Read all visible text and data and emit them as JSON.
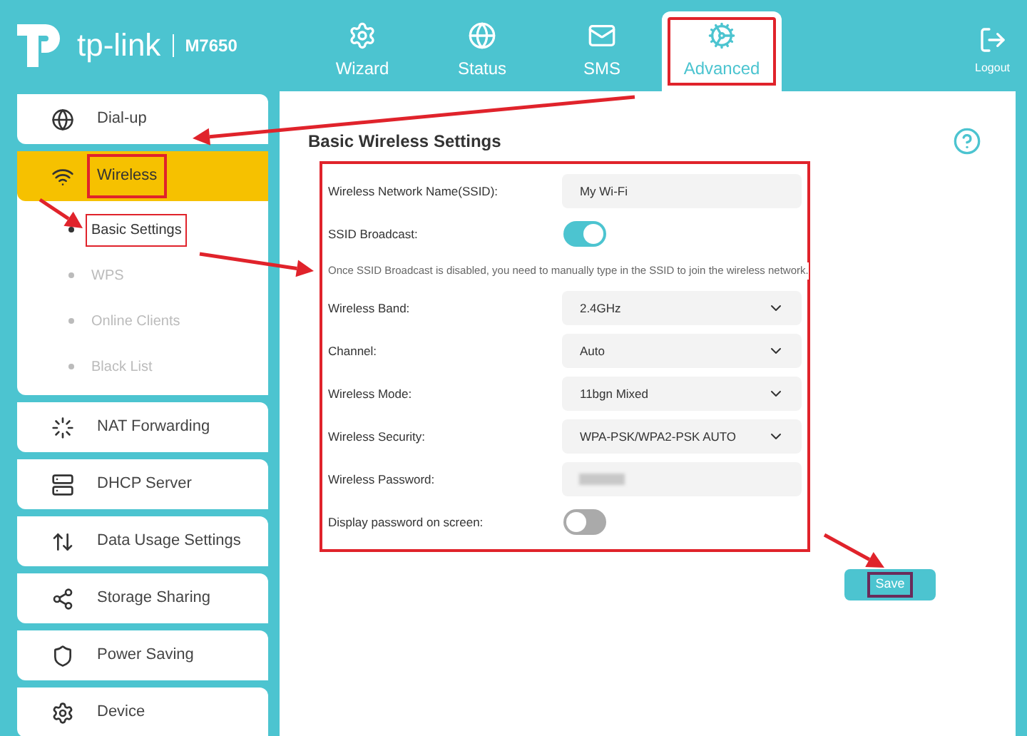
{
  "header": {
    "brand": "tp-link",
    "model": "M7650",
    "tabs": [
      {
        "label": "Wizard",
        "selected": false,
        "annotated": false
      },
      {
        "label": "Status",
        "selected": false,
        "annotated": false
      },
      {
        "label": "SMS",
        "selected": false,
        "annotated": false
      },
      {
        "label": "Advanced",
        "selected": true,
        "annotated": true
      }
    ],
    "logout": "Logout"
  },
  "sidebar": {
    "items": [
      {
        "label": "Dial-up",
        "selected": false,
        "annotated": false
      },
      {
        "label": "Wireless",
        "selected": true,
        "annotated": true,
        "children": [
          {
            "label": "Basic Settings",
            "selected": true,
            "annotated": true
          },
          {
            "label": "WPS",
            "selected": false,
            "annotated": false
          },
          {
            "label": "Online Clients",
            "selected": false,
            "annotated": false
          },
          {
            "label": "Black List",
            "selected": false,
            "annotated": false
          }
        ]
      },
      {
        "label": "NAT Forwarding",
        "selected": false,
        "annotated": false
      },
      {
        "label": "DHCP Server",
        "selected": false,
        "annotated": false
      },
      {
        "label": "Data Usage Settings",
        "selected": false,
        "annotated": false
      },
      {
        "label": "Storage Sharing",
        "selected": false,
        "annotated": false
      },
      {
        "label": "Power Saving",
        "selected": false,
        "annotated": false
      },
      {
        "label": "Device",
        "selected": false,
        "annotated": false
      }
    ]
  },
  "main": {
    "title": "Basic Wireless Settings",
    "fields": [
      {
        "kind": "text",
        "label": "Wireless Network Name(SSID):",
        "value": "My Wi-Fi"
      },
      {
        "kind": "toggle",
        "label": "SSID Broadcast:",
        "on": true
      },
      {
        "kind": "note",
        "text": "Once SSID Broadcast is disabled, you need to manually type in the SSID to join the wireless network."
      },
      {
        "kind": "select",
        "label": "Wireless Band:",
        "value": "2.4GHz"
      },
      {
        "kind": "select",
        "label": "Channel:",
        "value": "Auto"
      },
      {
        "kind": "select",
        "label": "Wireless Mode:",
        "value": "11bgn Mixed"
      },
      {
        "kind": "select",
        "label": "Wireless Security:",
        "value": "WPA-PSK/WPA2-PSK AUTO"
      },
      {
        "kind": "password",
        "label": "Wireless Password:"
      },
      {
        "kind": "toggle",
        "label": "Display password on screen:",
        "on": false
      }
    ],
    "save": {
      "label": "Save",
      "annotated": true
    }
  }
}
